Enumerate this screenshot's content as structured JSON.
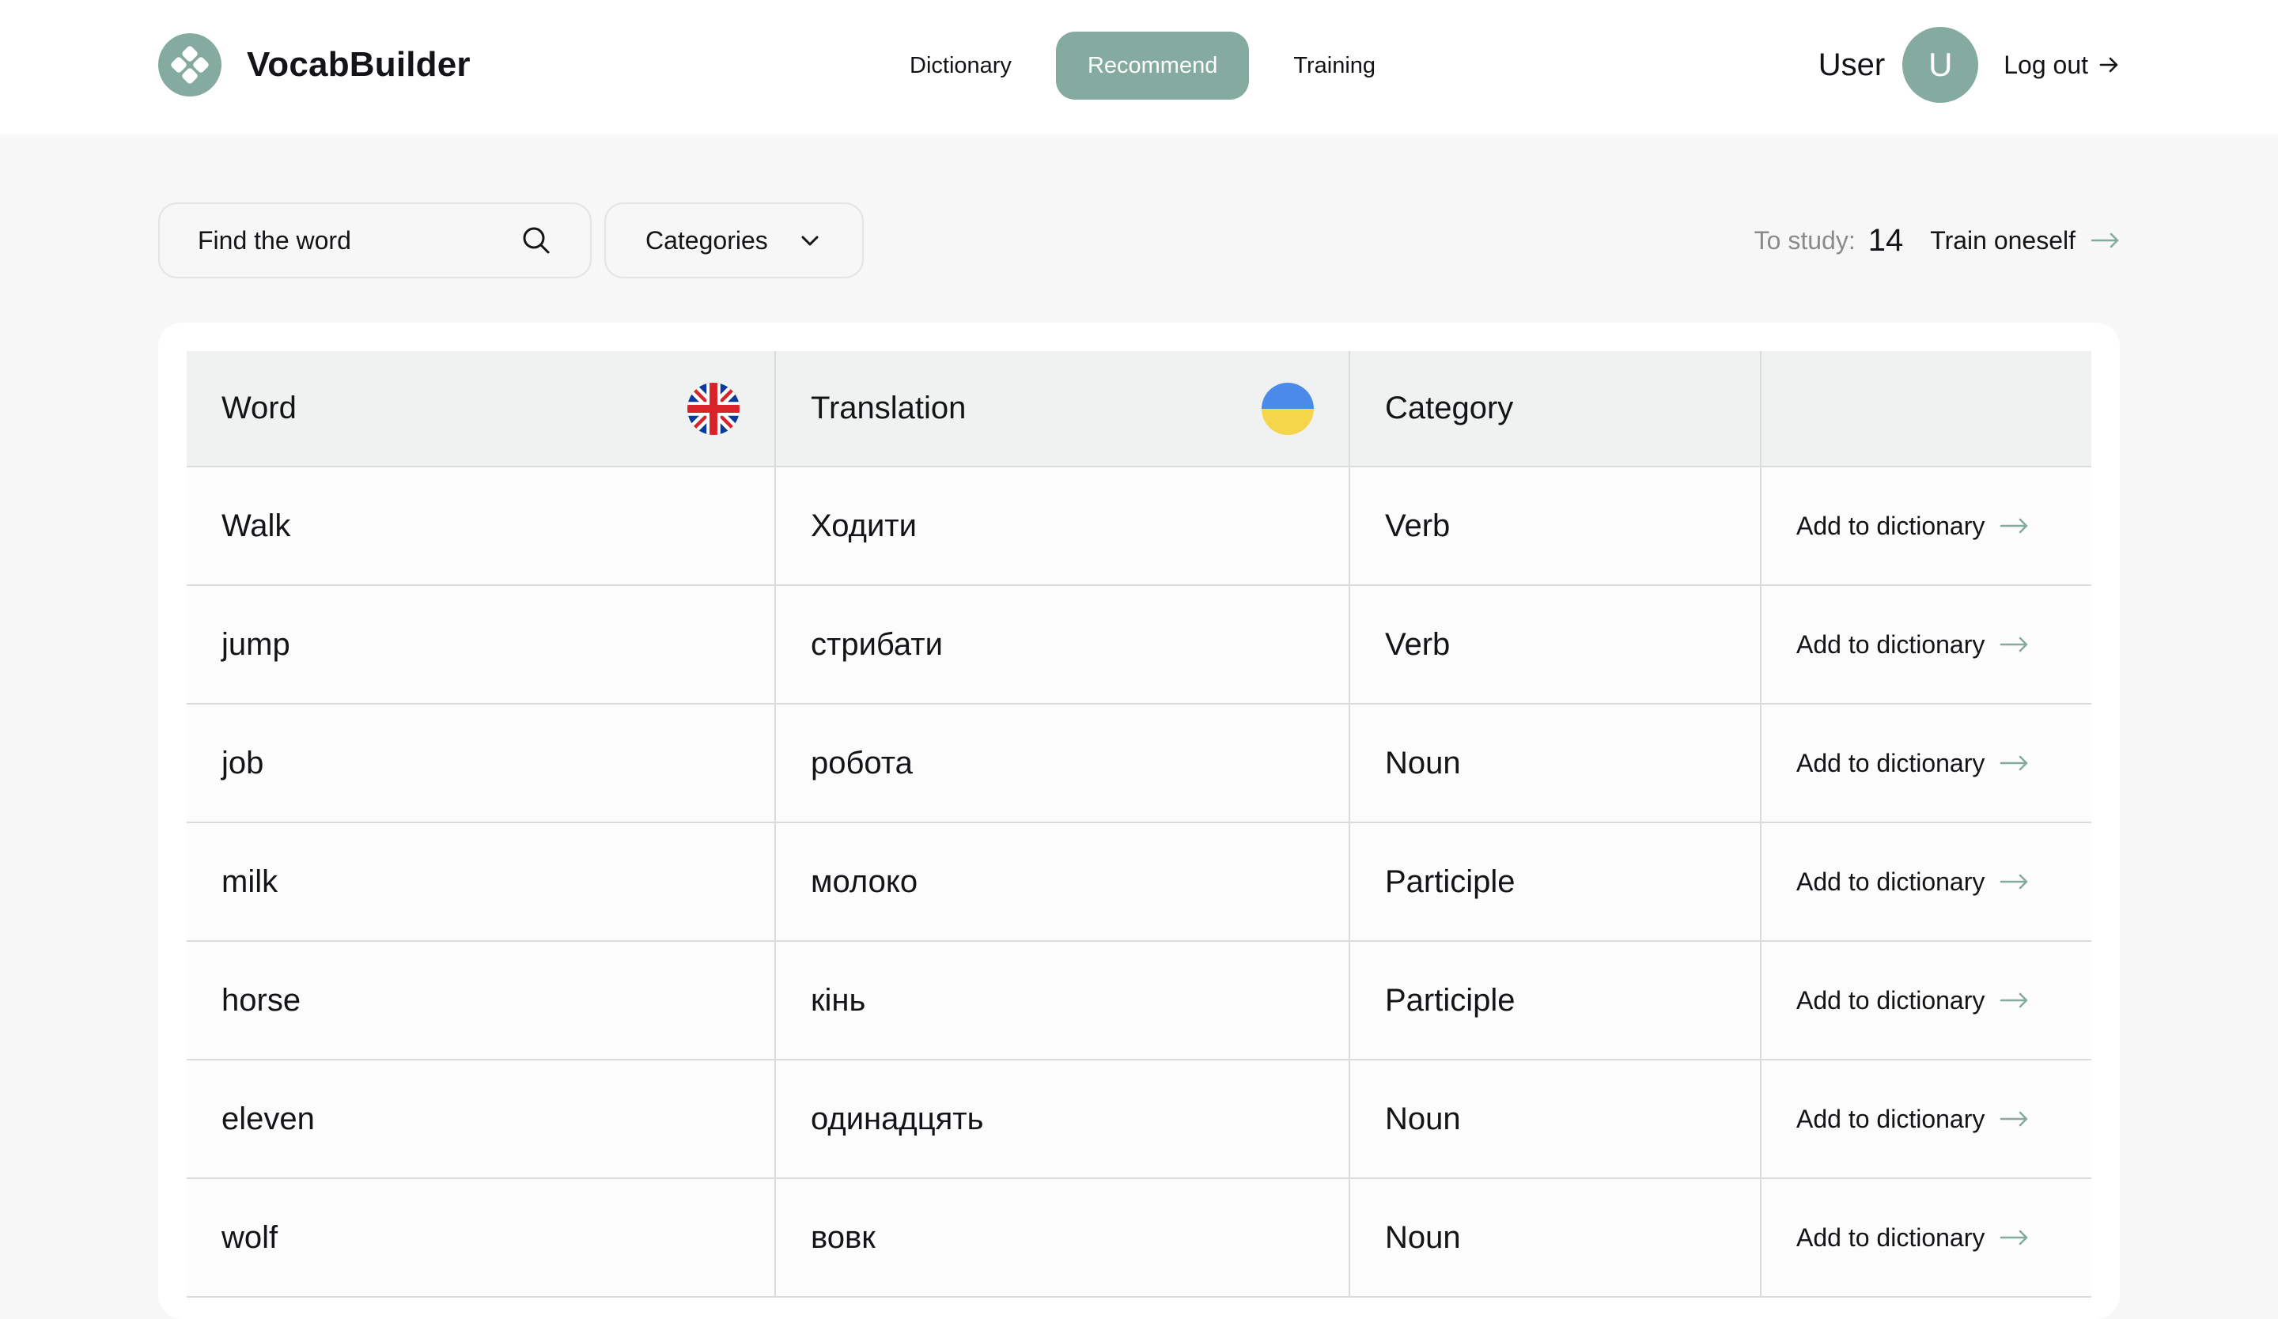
{
  "app": {
    "title": "VocabBuilder"
  },
  "nav": {
    "items": [
      {
        "label": "Dictionary",
        "active": false
      },
      {
        "label": "Recommend",
        "active": true
      },
      {
        "label": "Training",
        "active": false
      }
    ]
  },
  "user": {
    "name": "User",
    "avatar_initial": "U",
    "logout_label": "Log out"
  },
  "toolbar": {
    "search_placeholder": "Find the word",
    "categories_label": "Categories",
    "to_study_label": "To study:",
    "to_study_count": "14",
    "train_label": "Train oneself"
  },
  "table": {
    "columns": [
      "Word",
      "Translation",
      "Category",
      ""
    ],
    "action_label": "Add to dictionary",
    "rows": [
      {
        "word": "Walk",
        "translation": "Ходити",
        "category": "Verb"
      },
      {
        "word": "jump",
        "translation": "стрибати",
        "category": "Verb"
      },
      {
        "word": "job",
        "translation": "робота",
        "category": "Noun"
      },
      {
        "word": "milk",
        "translation": "молоко",
        "category": "Participle"
      },
      {
        "word": "horse",
        "translation": "кінь",
        "category": "Participle"
      },
      {
        "word": "eleven",
        "translation": "одинадцять",
        "category": "Noun"
      },
      {
        "word": "wolf",
        "translation": "вовк",
        "category": "Noun"
      }
    ]
  },
  "colors": {
    "accent": "#85aa9f",
    "text": "#121417",
    "muted": "#8a8a89",
    "page_bg": "#f7f7f7",
    "header_row_bg": "#f0f2f1"
  },
  "icons": {
    "logo": "logo-icon",
    "search": "search-icon",
    "chevron": "chevron-down-icon",
    "arrow": "arrow-right-icon",
    "uk_flag": "uk-flag-icon",
    "ua_flag": "ukraine-flag-icon"
  }
}
